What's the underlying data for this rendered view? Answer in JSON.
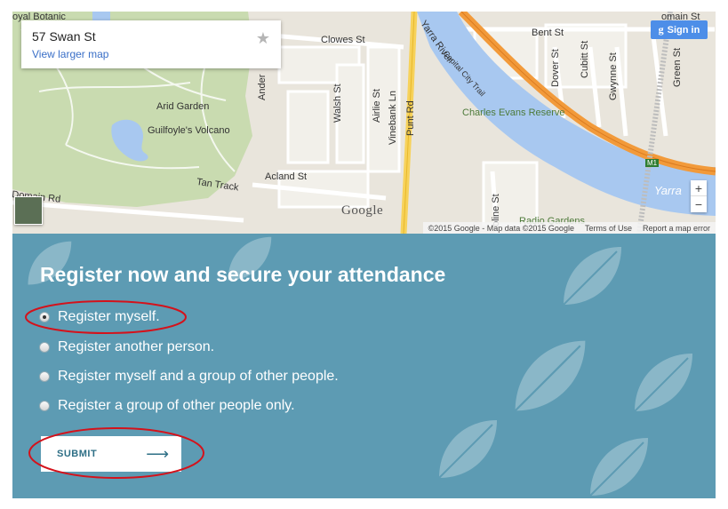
{
  "map": {
    "info_card": {
      "address": "57 Swan St",
      "larger_map_link": "View larger map"
    },
    "sign_in_label": "Sign in",
    "google_logo": "Google",
    "labels": {
      "royal_botanic": "oyal Botanic",
      "domain_st": "omain St",
      "clowes_st": "Clowes St",
      "bent_st": "Bent St",
      "dover_st": "Dover St",
      "cubitt_st": "Cubitt St",
      "gwynne_st": "Gwynne St",
      "green_st": "Green St",
      "yarra_river": "Yarra River",
      "capital_city_trail": "Capital City Trail",
      "charles_evans_reserve": "Charles Evans Reserve",
      "arid_garden": "Arid Garden",
      "guilfoyles_volcano": "Guilfoyle's Volcano",
      "tan_track": "Tan Track",
      "acland_st": "Acland St",
      "walsh_st": "Walsh St",
      "airlie_st": "Airlie St",
      "vinebank_ln": "Vinebank Ln",
      "punt_rd": "Punt Rd",
      "ander": "Ander",
      "domain_rd": "Domain Rd",
      "oline_st": "oline St",
      "yarra_bottom": "Yarra",
      "m1": "M1",
      "radio_gardens": "Radio Gardens"
    },
    "footer": {
      "copyright": "©2015 Google - Map data ©2015 Google",
      "terms": "Terms of Use",
      "report": "Report a map error"
    },
    "zoom_in": "+",
    "zoom_out": "−"
  },
  "form": {
    "title": "Register now and secure your attendance",
    "options": [
      {
        "label": "Register myself.",
        "checked": true
      },
      {
        "label": "Register another person.",
        "checked": false
      },
      {
        "label": "Register myself and a group of other people.",
        "checked": false
      },
      {
        "label": "Register a group of other people only.",
        "checked": false
      }
    ],
    "submit_label": "SUBMIT",
    "submit_arrow": "⟶"
  },
  "colors": {
    "panel_bg": "#5d9bb3",
    "annotation_red": "#d4121b",
    "river": "#a8c8f0",
    "freeway": "#f29a3a",
    "park": "#c9dbb0"
  }
}
